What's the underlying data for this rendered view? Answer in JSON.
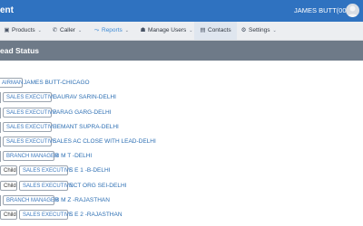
{
  "header": {
    "brand": "ent",
    "user_name": "JAMES BUTT(001)",
    "avatar_icon": "user-avatar-icon"
  },
  "nav": [
    {
      "label": "Products",
      "icon": "box-icon",
      "has_caret": true
    },
    {
      "label": "Caller",
      "icon": "phone-icon",
      "has_caret": true
    },
    {
      "label": "Reports",
      "icon": "chart-icon",
      "has_caret": true
    },
    {
      "label": "Manage Users",
      "icon": "users-icon",
      "has_caret": true
    },
    {
      "label": "Contacts",
      "icon": "contacts-icon",
      "has_caret": false
    },
    {
      "label": "Settings",
      "icon": "gear-icon",
      "has_caret": true
    }
  ],
  "panel": {
    "title": "ead Status"
  },
  "rows": [
    {
      "child": "",
      "role": "AIRMAN",
      "text": "JAMES BUTT-CHICAGO"
    },
    {
      "child": "",
      "role": "SALES EXECUTIVE",
      "text": "GAURAV SARIN-DELHI"
    },
    {
      "child": "",
      "role": "SALES EXECUTIVE",
      "text": "PARAG GARG-DELHI"
    },
    {
      "child": "",
      "role": "SALES EXECUTIVE",
      "text": "HEMANT SUPRA-DELHI"
    },
    {
      "child": "",
      "role": "SALES EXECUTIVE",
      "text": "SALES AC CLOSE WITH LEAD-DELHI"
    },
    {
      "child": "",
      "role": "BRANCH MANAGER",
      "text": "B M T -DELHI"
    },
    {
      "child": "Child",
      "role": "SALES EXECUTIVE",
      "text": "S E 1 -B-DELHI"
    },
    {
      "child": "Child",
      "role": "SALES EXECUTIVE",
      "text": "NCT ORG SEI-DELHI"
    },
    {
      "child": "",
      "role": "BRANCH MANAGER",
      "text": "B M Z -RAJASTHAN"
    },
    {
      "child": "Child",
      "role": "SALES EXECUTIVE",
      "text": "S E 2 -RAJASTHAN"
    }
  ],
  "colors": {
    "topbar": "#2f72c0",
    "navbar": "#eceef1",
    "panel_header": "#6e7a88",
    "link": "#2d6fb3"
  }
}
